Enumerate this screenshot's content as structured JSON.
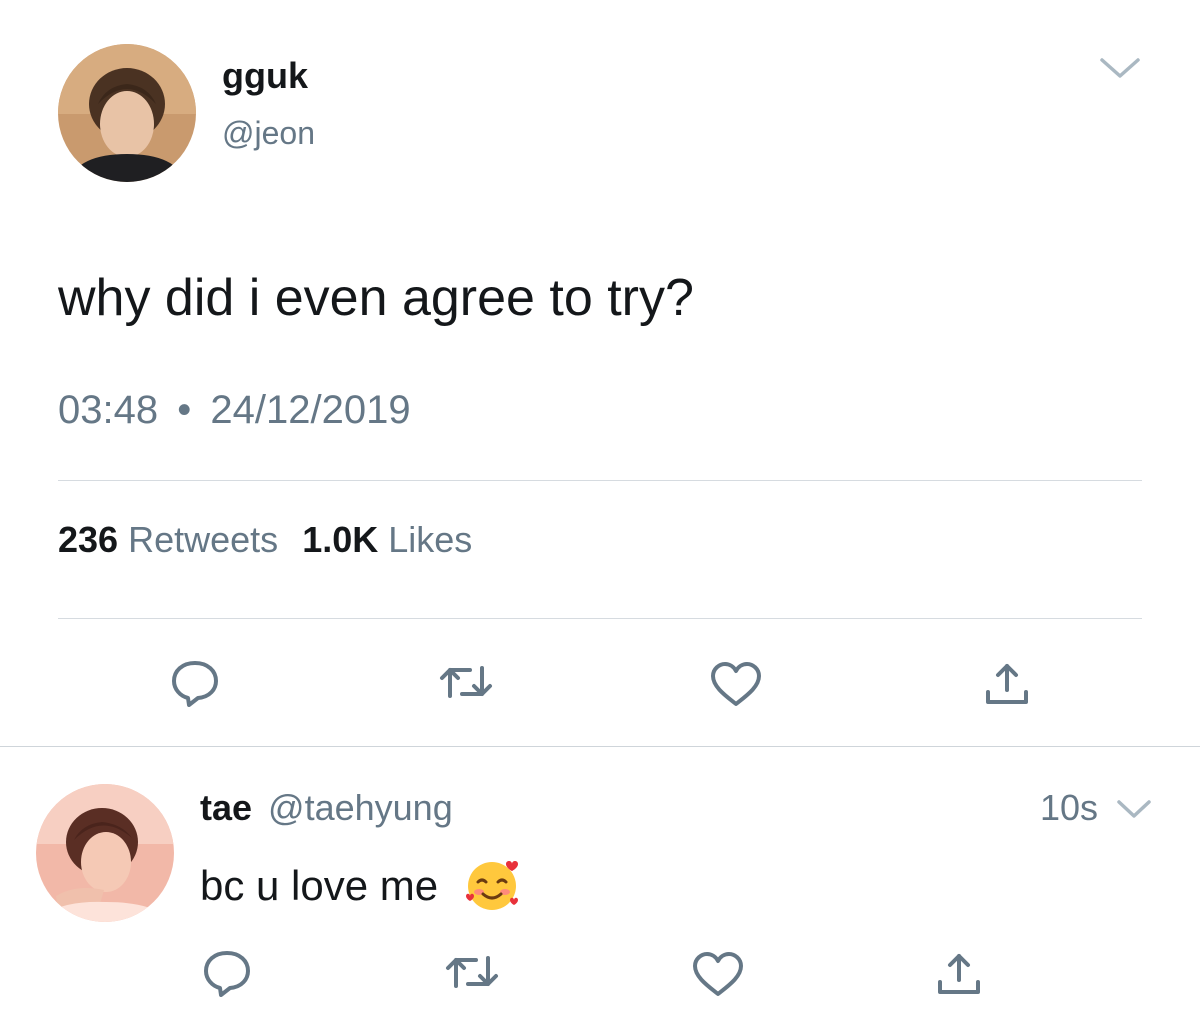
{
  "tweet": {
    "display_name": "gguk",
    "handle": "@jeon",
    "text": "why did i even agree to try?",
    "time": "03:48",
    "separator": "•",
    "date": "24/12/2019",
    "retweets_count": "236",
    "retweets_label": "Retweets",
    "likes_count": "1.0K",
    "likes_label": "Likes"
  },
  "reply": {
    "display_name": "tae",
    "handle": "@taehyung",
    "time": "10s",
    "text": "bc u love me",
    "emoji": "smiling-face-with-hearts"
  },
  "icons": {
    "caret": "chevron-down-icon",
    "reply": "reply-icon",
    "retweet": "retweet-icon",
    "like": "heart-icon",
    "share": "share-icon"
  },
  "colors": {
    "text": "#14171a",
    "secondary": "#657786",
    "icon": "#657786",
    "divider": "#d6dbe0"
  }
}
